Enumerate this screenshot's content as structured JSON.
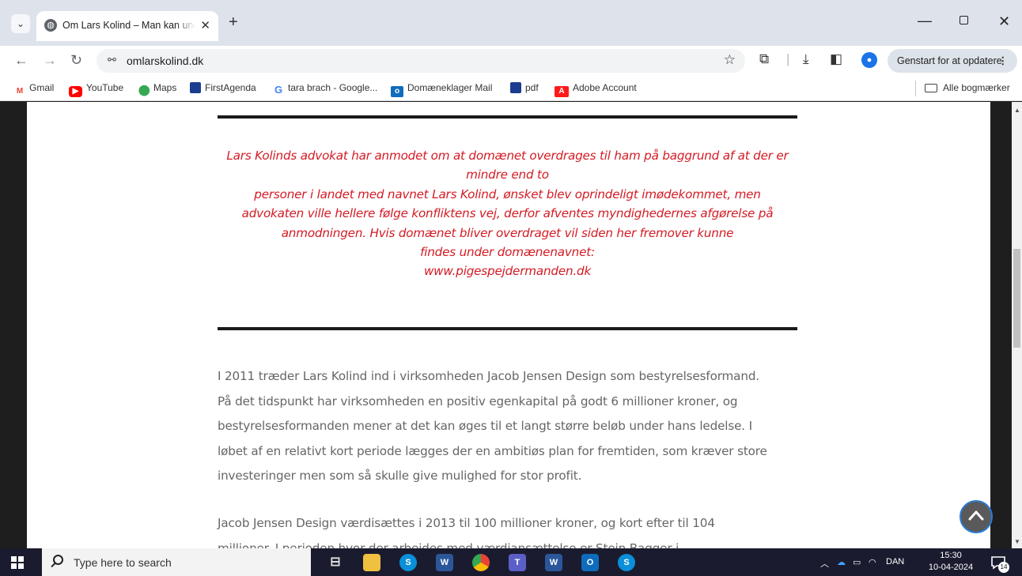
{
  "browser": {
    "tab_title": "Om Lars Kolind – Man kan undr",
    "url": "omlarskolind.dk",
    "update_button": "Genstart for at opdatere",
    "bookmarks": [
      "Gmail",
      "YouTube",
      "Maps",
      "FirstAgenda",
      "tara brach - Google...",
      "Domæneklager Mail",
      "pdf",
      "Adobe Account"
    ],
    "all_bookmarks": "Alle bogmærker"
  },
  "page": {
    "notice_lines": [
      "Lars Kolinds advokat har anmodet om at domænet overdrages til ham på baggrund af at der er",
      "mindre end to",
      "personer i landet med navnet Lars Kolind, ønsket blev oprindeligt imødekommet, men",
      "advokaten ville hellere følge konfliktens vej, derfor afventes myndighedernes afgørelse på",
      "anmodningen. Hvis domænet bliver overdraget vil siden her fremover kunne",
      "findes under domænenavnet:",
      "www.pigespejdermanden.dk"
    ],
    "paragraph1_lines": [
      "I 2011 træder Lars Kolind ind i virksomheden Jacob Jensen Design som bestyrelsesformand.",
      "På det tidspunkt har virksomheden en positiv egenkapital på godt 6 millioner kroner, og",
      "bestyrelsesformanden mener at det kan øges til et langt større beløb under hans ledelse. I",
      "løbet af en relativt kort periode lægges der en ambitiøs plan for fremtiden, som kræver store",
      "investeringer men som så skulle give mulighed for stor profit."
    ],
    "paragraph2_lines": [
      "Jacob Jensen Design værdisættes i 2013 til 100 millioner kroner, og kort efter til 104",
      "millioner. I perioden hvor der arbejdes med værdiansættelse er Stein Bagger i"
    ]
  },
  "taskbar": {
    "search_placeholder": "Type here to search",
    "language": "DAN",
    "time": "15:30",
    "date": "10-04-2024",
    "notification_count": "14"
  },
  "colors": {
    "notice_red": "#d31b24",
    "body_gray": "#666666",
    "rule": "#1a1a1a"
  }
}
